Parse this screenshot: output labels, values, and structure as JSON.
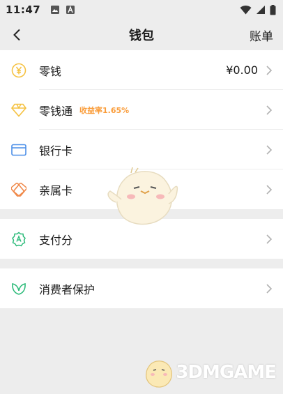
{
  "status_bar": {
    "time": "11:47"
  },
  "nav": {
    "title": "钱包",
    "action": "账单"
  },
  "groups": [
    {
      "items": [
        {
          "label": "零钱",
          "value": "¥0.00",
          "icon": "coin-icon",
          "color": "#f5c242"
        },
        {
          "label": "零钱通",
          "tag": "收益率1.65%",
          "icon": "diamond-icon",
          "color": "#f5c242"
        },
        {
          "label": "银行卡",
          "icon": "bank-card-icon",
          "color": "#4c8fe8"
        },
        {
          "label": "亲属卡",
          "icon": "family-card-icon",
          "color": "#f0894a"
        }
      ]
    },
    {
      "items": [
        {
          "label": "支付分",
          "icon": "pay-score-icon",
          "color": "#2dbb7a"
        }
      ]
    },
    {
      "items": [
        {
          "label": "消费者保护",
          "icon": "consumer-protect-icon",
          "color": "#2dbb7a"
        }
      ]
    }
  ],
  "watermark": {
    "text": "3DMGAME"
  }
}
